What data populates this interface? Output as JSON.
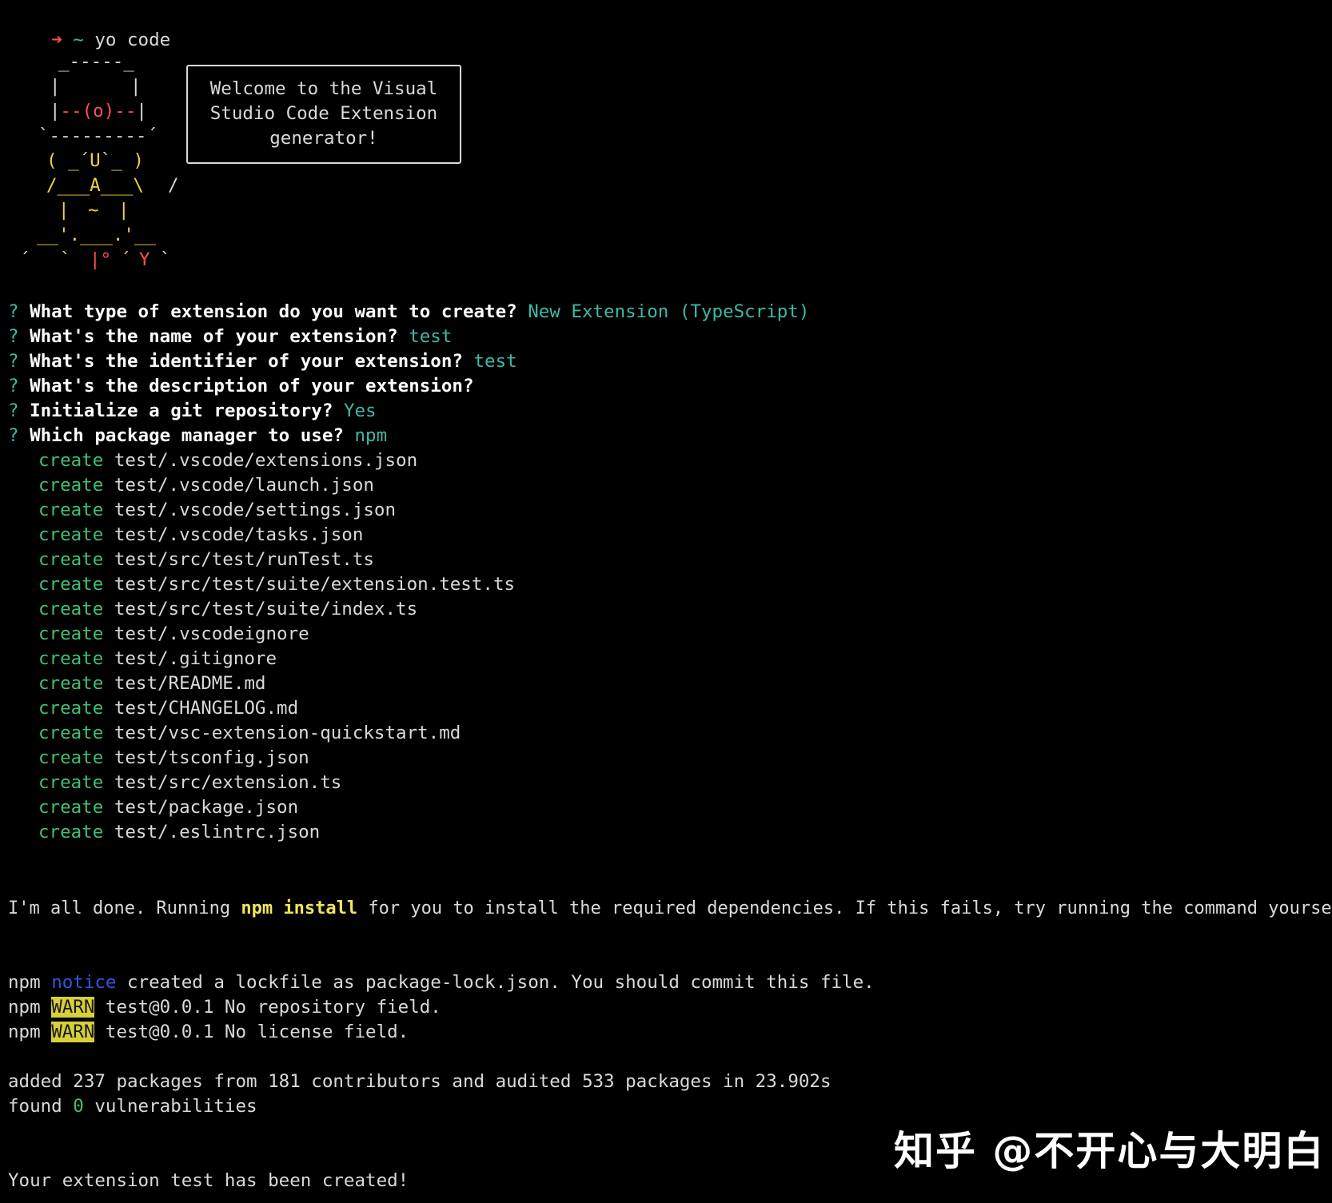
{
  "prompt": {
    "arrow": "➜",
    "tilde": "~",
    "command": "yo code"
  },
  "ascii_art": {
    "l1": "_-----_",
    "l2a": "|",
    "l2b": "|",
    "l3a": "|",
    "l3b": "--(o)--",
    "l3c": "|",
    "l4": "`---------´",
    "l5a": "( ",
    "l5b": "_´U`_",
    "l5c": " )",
    "l6a": "/___A___\\",
    "l6b": "/",
    "l7a": "|",
    "l7b": "~",
    "l7c": "|",
    "l8": "__'.___.'__",
    "l9a": "´",
    "l9b": "`",
    "l9c": "|°",
    "l9d": "´",
    "l9e": "Y",
    "l9f": "`"
  },
  "welcome": {
    "text": "Welcome to the Visual\nStudio Code Extension\ngenerator!"
  },
  "questions": [
    {
      "mark": "?",
      "question": "What type of extension do you want to create?",
      "answer": "New Extension (TypeScript)"
    },
    {
      "mark": "?",
      "question": "What's the name of your extension?",
      "answer": "test"
    },
    {
      "mark": "?",
      "question": "What's the identifier of your extension?",
      "answer": "test"
    },
    {
      "mark": "?",
      "question": "What's the description of your extension?",
      "answer": ""
    },
    {
      "mark": "?",
      "question": "Initialize a git repository?",
      "answer": "Yes"
    },
    {
      "mark": "?",
      "question": "Which package manager to use?",
      "answer": "npm"
    }
  ],
  "create_label": "create",
  "created_files": [
    "test/.vscode/extensions.json",
    "test/.vscode/launch.json",
    "test/.vscode/settings.json",
    "test/.vscode/tasks.json",
    "test/src/test/runTest.ts",
    "test/src/test/suite/extension.test.ts",
    "test/src/test/suite/index.ts",
    "test/.vscodeignore",
    "test/.gitignore",
    "test/README.md",
    "test/CHANGELOG.md",
    "test/vsc-extension-quickstart.md",
    "test/tsconfig.json",
    "test/src/extension.ts",
    "test/package.json",
    "test/.eslintrc.json"
  ],
  "done": {
    "pre": "I'm all done. Running ",
    "cmd": "npm install",
    "post": " for you to install the required dependencies. If this fails, try running the command yourself."
  },
  "npm_lines": [
    {
      "prefix": "npm",
      "level": "notice",
      "msg": " created a lockfile as package-lock.json. You should commit this file."
    },
    {
      "prefix": "npm",
      "level": "WARN",
      "msg": " test@0.0.1 No repository field."
    },
    {
      "prefix": "npm",
      "level": "WARN",
      "msg": " test@0.0.1 No license field."
    }
  ],
  "summary": {
    "added": "added 237 packages from 181 contributors and audited 533 packages in 23.902s",
    "found_pre": "found ",
    "found_num": "0",
    "found_post": " vulnerabilities"
  },
  "final": "Your extension test has been created!",
  "watermark": "知乎 @不开心与大明白",
  "colors": {
    "background": "#000000",
    "answer": "#3fb8a5",
    "create": "#3fbf75",
    "arrow": "#ff4f4f",
    "notice": "#2f56e0",
    "warn_bg": "#d6d03a",
    "npm_install": "#f1e65a"
  }
}
